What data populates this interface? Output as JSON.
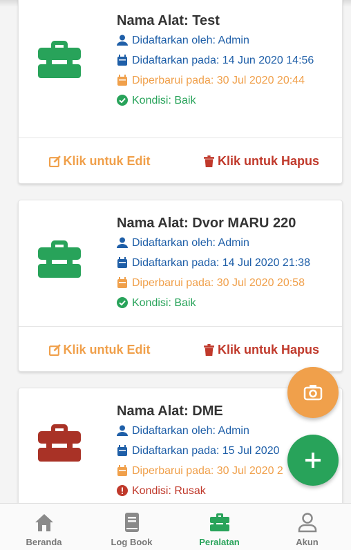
{
  "cards": [
    {
      "name": "Nama Alat: Test",
      "registered_by": "Didaftarkan oleh: Admin",
      "registered_at": "Didaftarkan pada: 14 Jun 2020 14:56",
      "updated_at": "Diperbarui pada: 30 Jul 2020 20:44",
      "condition": "Kondisi: Baik",
      "condition_status": "good",
      "edit_label": "Klik untuk Edit",
      "delete_label": "Klik untuk Hapus"
    },
    {
      "name": "Nama Alat: Dvor MARU 220",
      "registered_by": "Didaftarkan oleh: Admin",
      "registered_at": "Didaftarkan pada: 14 Jul 2020 21:38",
      "updated_at": "Diperbarui pada: 30 Jul 2020 20:58",
      "condition": "Kondisi: Baik",
      "condition_status": "good",
      "edit_label": "Klik untuk Edit",
      "delete_label": "Klik untuk Hapus"
    },
    {
      "name": "Nama Alat: DME",
      "registered_by": "Didaftarkan oleh: Admin",
      "registered_at": "Didaftarkan pada: 15 Jul 2020",
      "updated_at": "Diperbarui pada: 30 Jul 2020 2",
      "condition": "Kondisi: Rusak",
      "condition_status": "broken"
    }
  ],
  "nav": {
    "home": "Beranda",
    "logbook": "Log Book",
    "tools": "Peralatan",
    "account": "Akun"
  },
  "colors": {
    "green": "#28a35a",
    "orange": "#f0a04b",
    "blue": "#1f5fa8",
    "red": "#c0392b",
    "broken_icon": "#a93226"
  },
  "icons": {
    "tool": "toolbox-icon",
    "user": "user-icon",
    "calendar": "calendar-icon",
    "check": "check-circle-icon",
    "alert": "exclamation-circle-icon",
    "edit": "edit-icon",
    "delete": "trash-icon",
    "camera": "camera-icon",
    "add": "plus-icon"
  }
}
